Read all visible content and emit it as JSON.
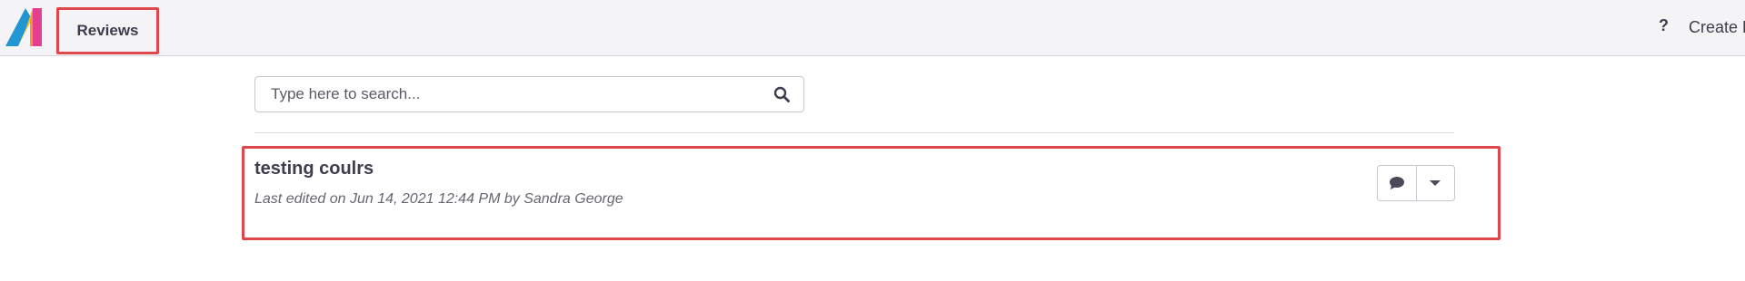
{
  "header": {
    "logo_icon": "app-logo-icon",
    "nav_tab_label": "Reviews",
    "help_icon": "?",
    "create_label": "Create B"
  },
  "search": {
    "placeholder": "Type here to search...",
    "value": "",
    "icon": "search-icon"
  },
  "reviews": [
    {
      "title": "testing coulrs",
      "meta": "Last edited on Jun 14, 2021 12:44 PM by Sandra George",
      "actions": [
        "comment-icon",
        "chevron-down-icon"
      ]
    }
  ],
  "colors": {
    "highlight": "#e0474c",
    "topbar_bg": "#f4f4f6",
    "text": "#3d3d4e",
    "logo_blue": "#2196d3",
    "logo_yellow": "#f5c21b",
    "logo_pink": "#e53e8f"
  }
}
